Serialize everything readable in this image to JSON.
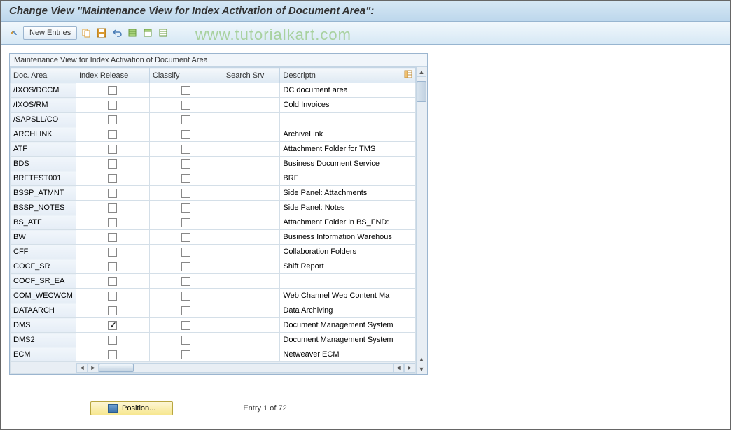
{
  "header": {
    "title": "Change View \"Maintenance View for Index Activation of Document Area\":"
  },
  "toolbar": {
    "new_entries": "New Entries"
  },
  "watermark": "www.tutorialkart.com",
  "table": {
    "title": "Maintenance View for Index Activation of Document Area",
    "columns": {
      "area": "Doc. Area",
      "release": "Index Release",
      "classify": "Classify",
      "search": "Search Srv",
      "desc": "Descriptn"
    },
    "rows": [
      {
        "area": "/IXOS/DCCM",
        "release": false,
        "classify": false,
        "search": "",
        "desc": "DC document area"
      },
      {
        "area": "/IXOS/RM",
        "release": false,
        "classify": false,
        "search": "",
        "desc": "Cold Invoices"
      },
      {
        "area": "/SAPSLL/CO",
        "release": false,
        "classify": false,
        "search": "",
        "desc": ""
      },
      {
        "area": "ARCHLINK",
        "release": false,
        "classify": false,
        "search": "",
        "desc": "ArchiveLink"
      },
      {
        "area": "ATF",
        "release": false,
        "classify": false,
        "search": "",
        "desc": "Attachment Folder for TMS"
      },
      {
        "area": "BDS",
        "release": false,
        "classify": false,
        "search": "",
        "desc": "Business Document Service"
      },
      {
        "area": "BRFTEST001",
        "release": false,
        "classify": false,
        "search": "",
        "desc": "BRF"
      },
      {
        "area": "BSSP_ATMNT",
        "release": false,
        "classify": false,
        "search": "",
        "desc": "Side Panel: Attachments"
      },
      {
        "area": "BSSP_NOTES",
        "release": false,
        "classify": false,
        "search": "",
        "desc": "Side Panel: Notes"
      },
      {
        "area": "BS_ATF",
        "release": false,
        "classify": false,
        "search": "",
        "desc": "Attachment Folder in BS_FND:"
      },
      {
        "area": "BW",
        "release": false,
        "classify": false,
        "search": "",
        "desc": "Business Information Warehous"
      },
      {
        "area": "CFF",
        "release": false,
        "classify": false,
        "search": "",
        "desc": "Collaboration Folders"
      },
      {
        "area": "COCF_SR",
        "release": false,
        "classify": false,
        "search": "",
        "desc": "Shift Report"
      },
      {
        "area": "COCF_SR_EA",
        "release": false,
        "classify": false,
        "search": "",
        "desc": ""
      },
      {
        "area": "COM_WECWCM",
        "release": false,
        "classify": false,
        "search": "",
        "desc": "Web Channel Web Content Ma"
      },
      {
        "area": "DATAARCH",
        "release": false,
        "classify": false,
        "search": "",
        "desc": "Data Archiving"
      },
      {
        "area": "DMS",
        "release": true,
        "classify": false,
        "search": "",
        "desc": "Document Management System"
      },
      {
        "area": "DMS2",
        "release": false,
        "classify": false,
        "search": "",
        "desc": "Document Management System"
      },
      {
        "area": "ECM",
        "release": false,
        "classify": false,
        "search": "",
        "desc": "Netweaver ECM"
      }
    ]
  },
  "footer": {
    "position": "Position...",
    "entry": "Entry 1 of 72"
  }
}
